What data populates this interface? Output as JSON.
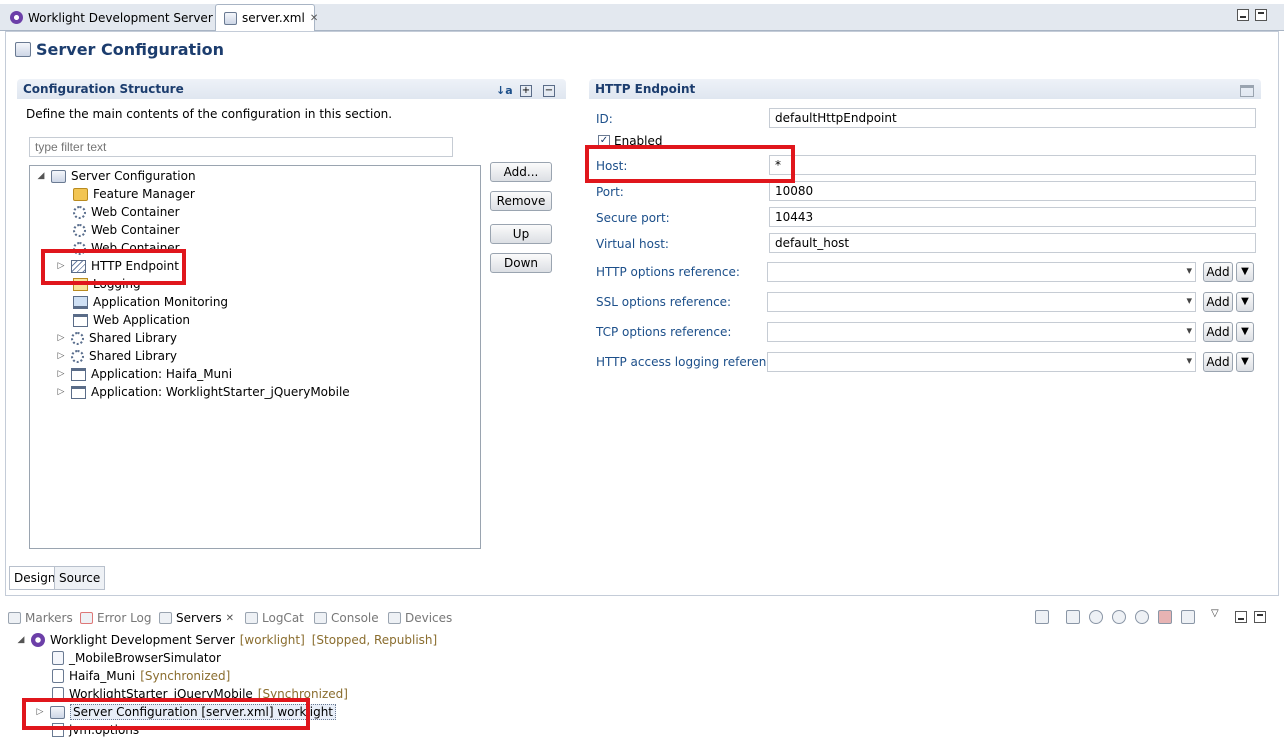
{
  "editor_tabs": [
    {
      "label": "Worklight Development Server",
      "active": false
    },
    {
      "label": "server.xml",
      "active": true
    }
  ],
  "page_title": "Server Configuration",
  "structure": {
    "title": "Configuration Structure",
    "description": "Define the main contents of the configuration in this section.",
    "filter_placeholder": "type filter text",
    "tree": [
      {
        "label": "Server Configuration",
        "icon": "server-config-icon",
        "expanded": true,
        "level": 0
      },
      {
        "label": "Feature Manager",
        "icon": "feature-manager-icon",
        "level": 1
      },
      {
        "label": "Web Container",
        "icon": "gear-icon",
        "level": 1
      },
      {
        "label": "Web Container",
        "icon": "gear-icon",
        "level": 1
      },
      {
        "label": "Web Container",
        "icon": "gear-icon",
        "level": 1
      },
      {
        "label": "HTTP Endpoint",
        "icon": "endpoint-icon",
        "level": 1,
        "has_children": true
      },
      {
        "label": "Logging",
        "icon": "logging-icon",
        "level": 1
      },
      {
        "label": "Application Monitoring",
        "icon": "monitor-icon",
        "level": 1
      },
      {
        "label": "Web Application",
        "icon": "window-icon",
        "level": 1
      },
      {
        "label": "Shared Library",
        "icon": "gear-icon",
        "level": 1,
        "has_children": true
      },
      {
        "label": "Shared Library",
        "icon": "gear-icon",
        "level": 1,
        "has_children": true
      },
      {
        "label": "Application: Haifa_Muni",
        "icon": "window-icon",
        "level": 1,
        "has_children": true
      },
      {
        "label": "Application: WorklightStarter_jQueryMobile",
        "icon": "window-icon",
        "level": 1,
        "has_children": true
      }
    ],
    "buttons": {
      "add": "Add...",
      "remove": "Remove",
      "up": "Up",
      "down": "Down"
    }
  },
  "endpoint": {
    "title": "HTTP Endpoint",
    "id_label": "ID:",
    "id_value": "defaultHttpEndpoint",
    "enabled_label": "Enabled",
    "enabled": true,
    "host_label": "Host:",
    "host_value": "*",
    "port_label": "Port:",
    "port_value": "10080",
    "secure_port_label": "Secure port:",
    "secure_port_value": "10443",
    "virtual_host_label": "Virtual host:",
    "virtual_host_value": "default_host",
    "http_options_label": "HTTP options reference:",
    "ssl_options_label": "SSL options reference:",
    "tcp_options_label": "TCP options reference:",
    "http_access_label": "HTTP access logging reference:",
    "add_label": "Add"
  },
  "editor_bottom_tabs": [
    "Design",
    "Source"
  ],
  "panel_tabs": [
    {
      "label": "Markers",
      "icon": "markers-icon",
      "active": false
    },
    {
      "label": "Error Log",
      "icon": "error-log-icon",
      "active": false
    },
    {
      "label": "Servers",
      "icon": "servers-icon",
      "active": true
    },
    {
      "label": "LogCat",
      "icon": "logcat-icon",
      "active": false
    },
    {
      "label": "Console",
      "icon": "console-icon",
      "active": false
    },
    {
      "label": "Devices",
      "icon": "devices-icon",
      "active": false
    }
  ],
  "servers": {
    "server_name": "Worklight Development Server",
    "server_tag": "[worklight]",
    "server_status": "[Stopped, Republish]",
    "children": [
      {
        "label": "_MobileBrowserSimulator",
        "status": ""
      },
      {
        "label": "Haifa_Muni",
        "status": "[Synchronized]"
      },
      {
        "label": "WorklightStarter_jQueryMobile",
        "status": "[Synchronized]"
      },
      {
        "label": "Server Configuration [server.xml] worklight",
        "status": ""
      },
      {
        "label": "jvm.options",
        "status": ""
      }
    ]
  }
}
